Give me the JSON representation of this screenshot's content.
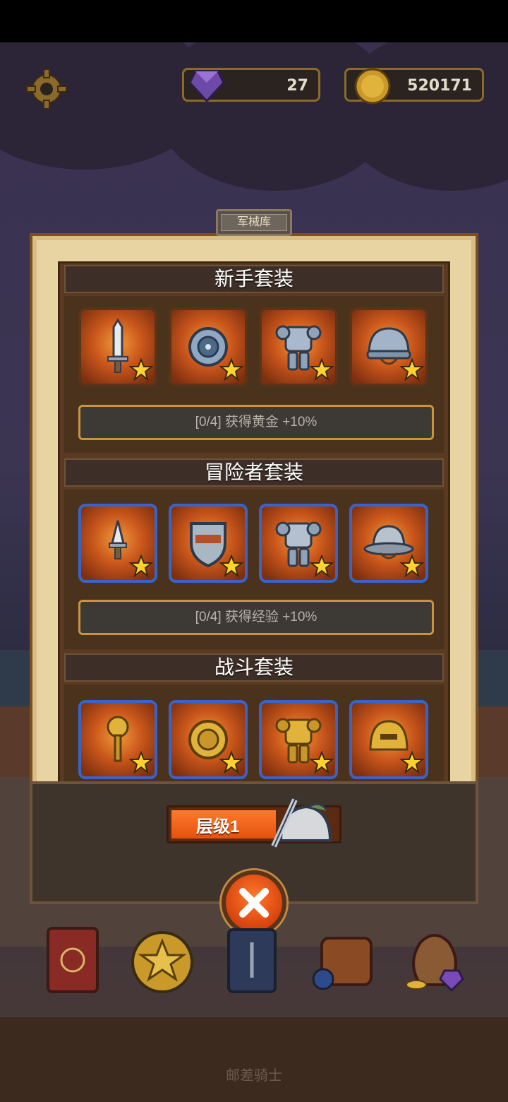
{
  "hud": {
    "gems": "27",
    "coins": "520171"
  },
  "panel": {
    "tab_label": "军械库"
  },
  "sets": [
    {
      "title": "新手套装",
      "bonus": "[0/4] 获得黄金 +10%",
      "items": [
        "sword-icon",
        "round-shield-icon",
        "plate-armor-icon",
        "helmet-icon"
      ],
      "frame": "plain"
    },
    {
      "title": "冒险者套装",
      "bonus": "[0/4] 获得经验 +10%",
      "items": [
        "dagger-icon",
        "kite-shield-icon",
        "plate-armor-icon",
        "kettle-helmet-icon"
      ],
      "frame": "blue"
    },
    {
      "title": "战斗套装",
      "items": [
        "mace-icon",
        "gold-shield-icon",
        "gold-armor-icon",
        "gold-helmet-icon"
      ],
      "frame": "blue"
    }
  ],
  "level": {
    "label": "层级1"
  },
  "footer": {
    "title": "邮差骑士"
  },
  "colors": {
    "accent_orange": "#e4520f",
    "frame_gold": "#c9943e",
    "rare_blue": "#3a63c9",
    "star_yellow": "#ffd22e"
  }
}
